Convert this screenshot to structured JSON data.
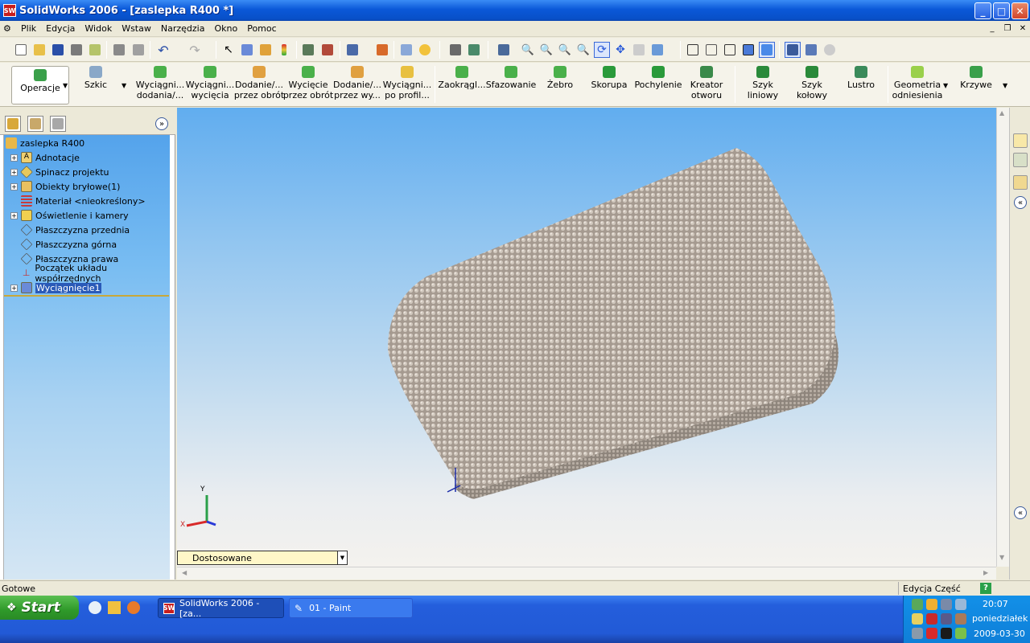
{
  "window": {
    "title": "SolidWorks 2006 - [zaslepka R400 *]",
    "app_logo": "SW"
  },
  "menu": [
    "Plik",
    "Edycja",
    "Widok",
    "Wstaw",
    "Narzędzia",
    "Okno",
    "Pomoc"
  ],
  "command_manager": {
    "operacje": "Operacje",
    "szkic": "Szkic",
    "items": [
      {
        "l1": "Wyciągni...",
        "l2": "dodania/..."
      },
      {
        "l1": "Wyciągni...",
        "l2": "wycięcia"
      },
      {
        "l1": "Dodanie/...",
        "l2": "przez obrót"
      },
      {
        "l1": "Wycięcie",
        "l2": "przez obrót"
      },
      {
        "l1": "Dodanie/...",
        "l2": "przez wy..."
      },
      {
        "l1": "Wyciągni...",
        "l2": "po profil..."
      },
      {
        "l1": "Zaokrągl...",
        "l2": ""
      },
      {
        "l1": "Sfazowanie",
        "l2": ""
      },
      {
        "l1": "Żebro",
        "l2": ""
      },
      {
        "l1": "Skorupa",
        "l2": ""
      },
      {
        "l1": "Pochylenie",
        "l2": ""
      },
      {
        "l1": "Kreator",
        "l2": "otworu"
      },
      {
        "l1": "Szyk",
        "l2": "liniowy"
      },
      {
        "l1": "Szyk",
        "l2": "kołowy"
      },
      {
        "l1": "Lustro",
        "l2": ""
      },
      {
        "l1": "Geometria",
        "l2": "odniesienia"
      },
      {
        "l1": "Krzywe",
        "l2": ""
      }
    ]
  },
  "feature_tree": {
    "root": "zaslepka R400",
    "items": [
      "Adnotacje",
      "Spinacz projektu",
      "Obiekty bryłowe(1)",
      "Materiał <nieokreślony>",
      "Oświetlenie i kamery",
      "Płaszczyzna przednia",
      "Płaszczyzna górna",
      "Płaszczyzna prawa",
      "Początek układu współrzędnych",
      "Wyciągnięcie1"
    ]
  },
  "viewport": {
    "triad_y": "Y",
    "triad_x": "X",
    "config_combo": "Dostosowane"
  },
  "status": {
    "left": "Gotowe",
    "right": "Edycja Część",
    "help": "?"
  },
  "taskbar": {
    "start": "Start",
    "buttons": [
      "SolidWorks 2006 - [za...",
      "01 - Paint"
    ],
    "time": "20:07",
    "day": "poniedziałek",
    "date": "2009-03-30"
  }
}
